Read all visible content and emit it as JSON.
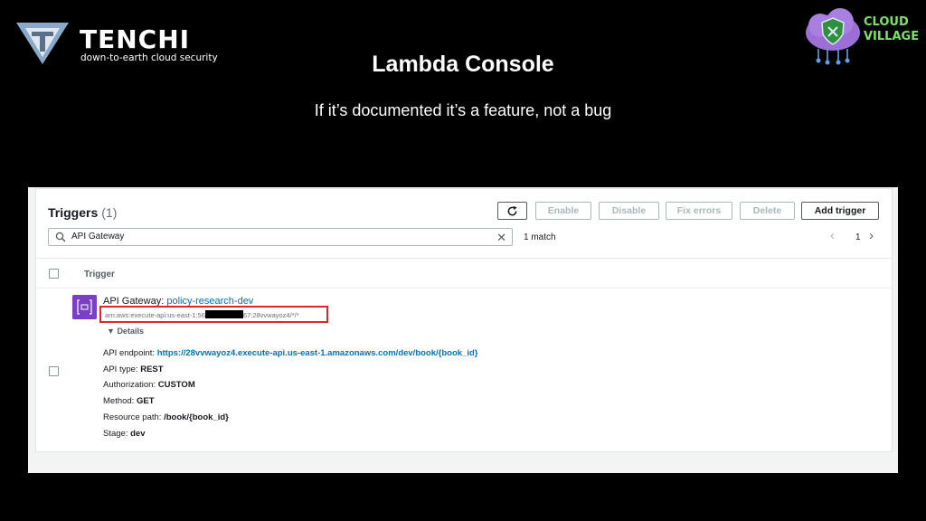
{
  "branding": {
    "name": "TENCHI",
    "tagline": "down-to-earth cloud security",
    "partner_line1": "CLOUD",
    "partner_line2": "VILLAGE"
  },
  "slide": {
    "title": "Lambda Console",
    "subtitle": "If it’s documented it’s a feature, not a bug"
  },
  "triggers": {
    "title": "Triggers",
    "count": "(1)",
    "buttons": {
      "enable": "Enable",
      "disable": "Disable",
      "fix_errors": "Fix errors",
      "delete": "Delete",
      "add_trigger": "Add trigger"
    },
    "search_value": "API Gateway",
    "match_text": "1 match",
    "page_number": "1",
    "column_header": "Trigger"
  },
  "trigger_row": {
    "source": "API Gateway",
    "separator": ": ",
    "api_name": "policy-research-dev",
    "arn_prefix": "arn:aws:execute-api:us-east-1:56",
    "arn_suffix": "67:28vvwayoz4/*/*",
    "details_label": "Details",
    "details": [
      {
        "label": "API endpoint:",
        "value": "https://28vvwayoz4.execute-api.us-east-1.amazonaws.com/dev/book/{book_id}"
      },
      {
        "label": "API type:",
        "value": "REST"
      },
      {
        "label": "Authorization:",
        "value": "CUSTOM"
      },
      {
        "label": "Method:",
        "value": "GET"
      },
      {
        "label": "Resource path:",
        "value": "/book/{book_id}"
      },
      {
        "label": "Stage:",
        "value": "dev"
      }
    ]
  },
  "colors": {
    "background": "#000000",
    "link": "#0073bb",
    "highlight": "#e0242a",
    "api_gateway": "#7b3fc7",
    "cloud_village": "#7ee06a"
  },
  "icons": [
    "tenchi-logo-icon",
    "cloud-village-logo-icon",
    "refresh-icon",
    "search-icon",
    "close-icon",
    "chevron-left-icon",
    "chevron-right-icon",
    "api-gateway-icon",
    "caret-down-icon"
  ]
}
